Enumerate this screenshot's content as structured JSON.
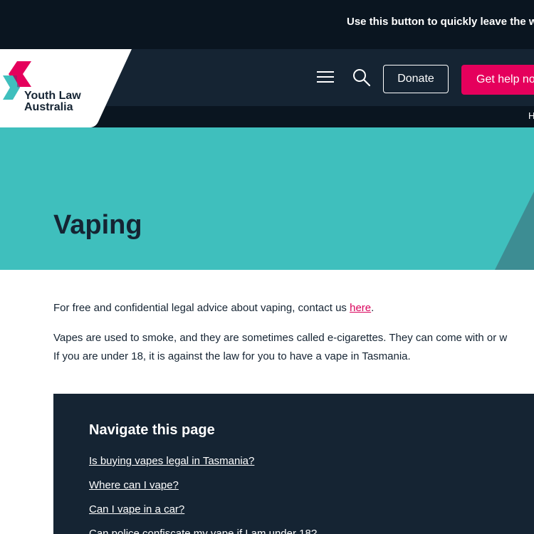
{
  "topbar": {
    "quick_exit": "Use this button to quickly leave the w"
  },
  "logo": {
    "line1": "Youth Law",
    "line2": "Australia"
  },
  "header": {
    "donate_label": "Donate",
    "help_label": "Get help no"
  },
  "subnav": {
    "text": "H"
  },
  "hero": {
    "title": "Vaping"
  },
  "content": {
    "p1_text": "For free and confidential legal advice about vaping, contact us ",
    "p1_link": "here",
    "p1_end": ".",
    "p2_line1": "Vapes are used to smoke, and they are sometimes called e-cigarettes. They can come with or w",
    "p2_line2": "If you are under 18, it is against the law for you to have a vape in Tasmania."
  },
  "nav_box": {
    "title": "Navigate this page",
    "links": [
      {
        "label": "Is buying vapes legal in Tasmania?"
      },
      {
        "label": "Where can I vape?"
      },
      {
        "label": "Can I vape in a car?"
      },
      {
        "label": "Can police confiscate my vape if I am under 18?"
      }
    ]
  },
  "colors": {
    "dark_navy": "#0a1520",
    "header_navy": "#152433",
    "teal": "#3fbfbd",
    "magenta": "#e5005c",
    "link_pink": "#d9005a"
  }
}
